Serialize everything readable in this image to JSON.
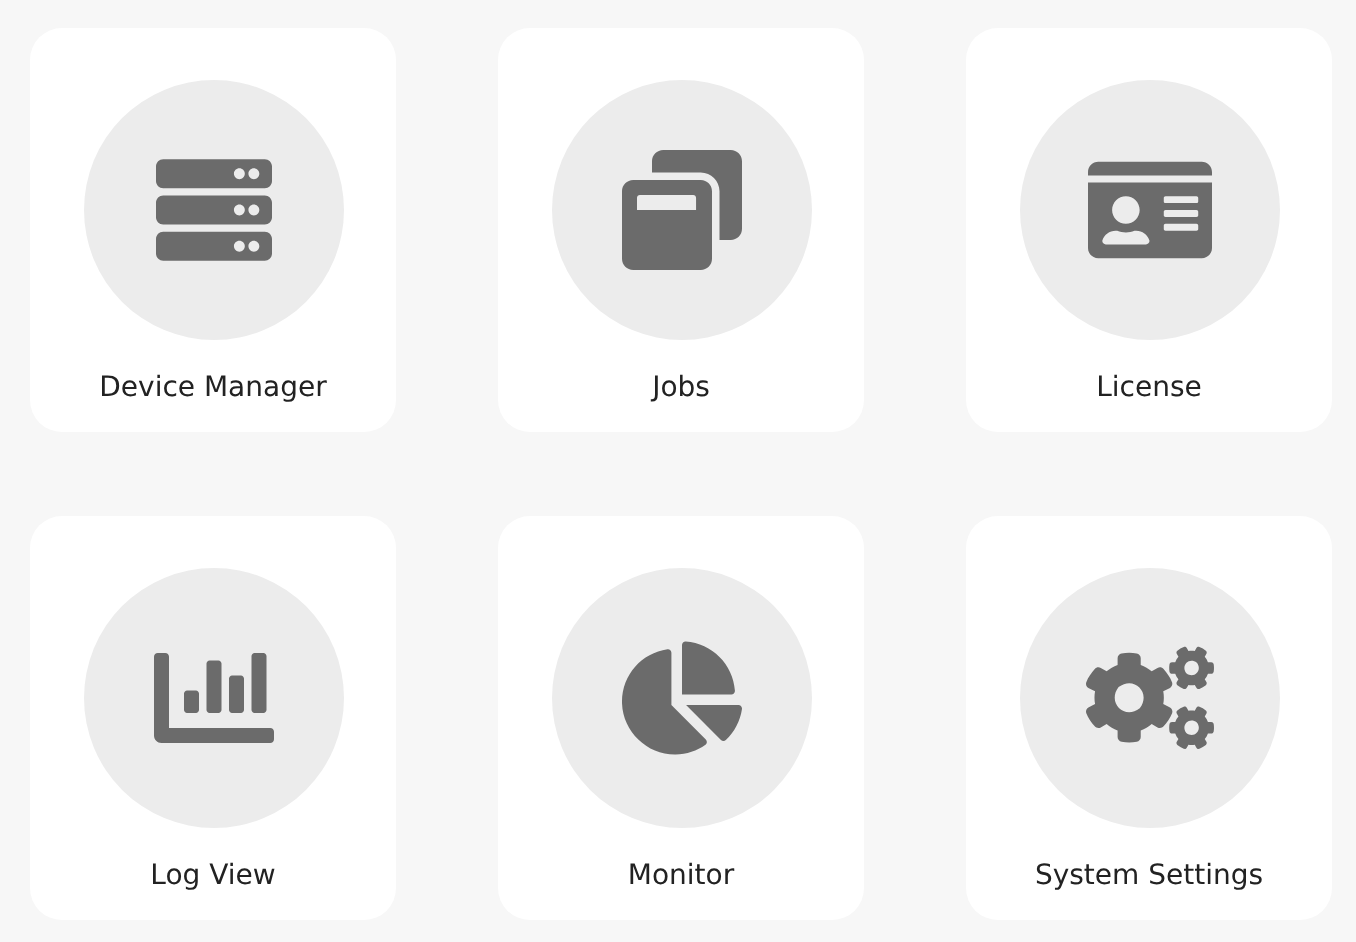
{
  "tiles": [
    {
      "label": "Device Manager",
      "kind": "server"
    },
    {
      "label": "Jobs",
      "kind": "windows"
    },
    {
      "label": "License",
      "kind": "idcard"
    },
    {
      "label": "Log View",
      "kind": "barchart"
    },
    {
      "label": "Monitor",
      "kind": "piechart"
    },
    {
      "label": "System Settings",
      "kind": "gears"
    }
  ]
}
